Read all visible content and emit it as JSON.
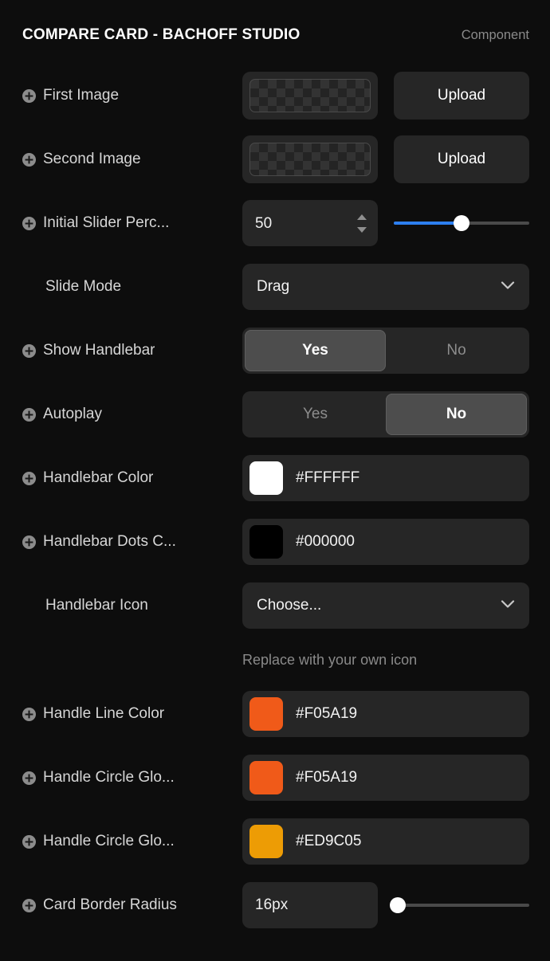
{
  "header": {
    "title": "COMPARE CARD - BACHOFF STUDIO",
    "kind": "Component"
  },
  "rows": {
    "first_image": {
      "label": "First Image",
      "upload_label": "Upload",
      "thumbnail": "checkerboard-placeholder"
    },
    "second_image": {
      "label": "Second Image",
      "upload_label": "Upload",
      "thumbnail": "checkerboard-placeholder"
    },
    "initial_slider_percent": {
      "label": "Initial Slider Perc...",
      "value": "50",
      "slider_percent": 50,
      "slider_fill_color": "#2D7FF0"
    },
    "slide_mode": {
      "label": "Slide Mode",
      "value": "Drag"
    },
    "show_handlebar": {
      "label": "Show Handlebar",
      "option_yes": "Yes",
      "option_no": "No",
      "selected": "Yes"
    },
    "autoplay": {
      "label": "Autoplay",
      "option_yes": "Yes",
      "option_no": "No",
      "selected": "No"
    },
    "handlebar_color": {
      "label": "Handlebar Color",
      "hex": "#FFFFFF",
      "swatch": "#FFFFFF"
    },
    "handlebar_dots_color": {
      "label": "Handlebar Dots C...",
      "hex": "#000000",
      "swatch": "#000000"
    },
    "handlebar_icon": {
      "label": "Handlebar Icon",
      "value": "Choose...",
      "helper": "Replace with your own icon"
    },
    "handle_line_color": {
      "label": "Handle Line Color",
      "hex": "#F05A19",
      "swatch": "#F05A19"
    },
    "handle_circle_glow_1": {
      "label": "Handle Circle Glo...",
      "hex": "#F05A19",
      "swatch": "#F05A19"
    },
    "handle_circle_glow_2": {
      "label": "Handle Circle Glo...",
      "hex": "#ED9C05",
      "swatch": "#ED9C05"
    },
    "card_border_radius": {
      "label": "Card Border Radius",
      "value": "16px",
      "slider_percent": 3
    }
  }
}
